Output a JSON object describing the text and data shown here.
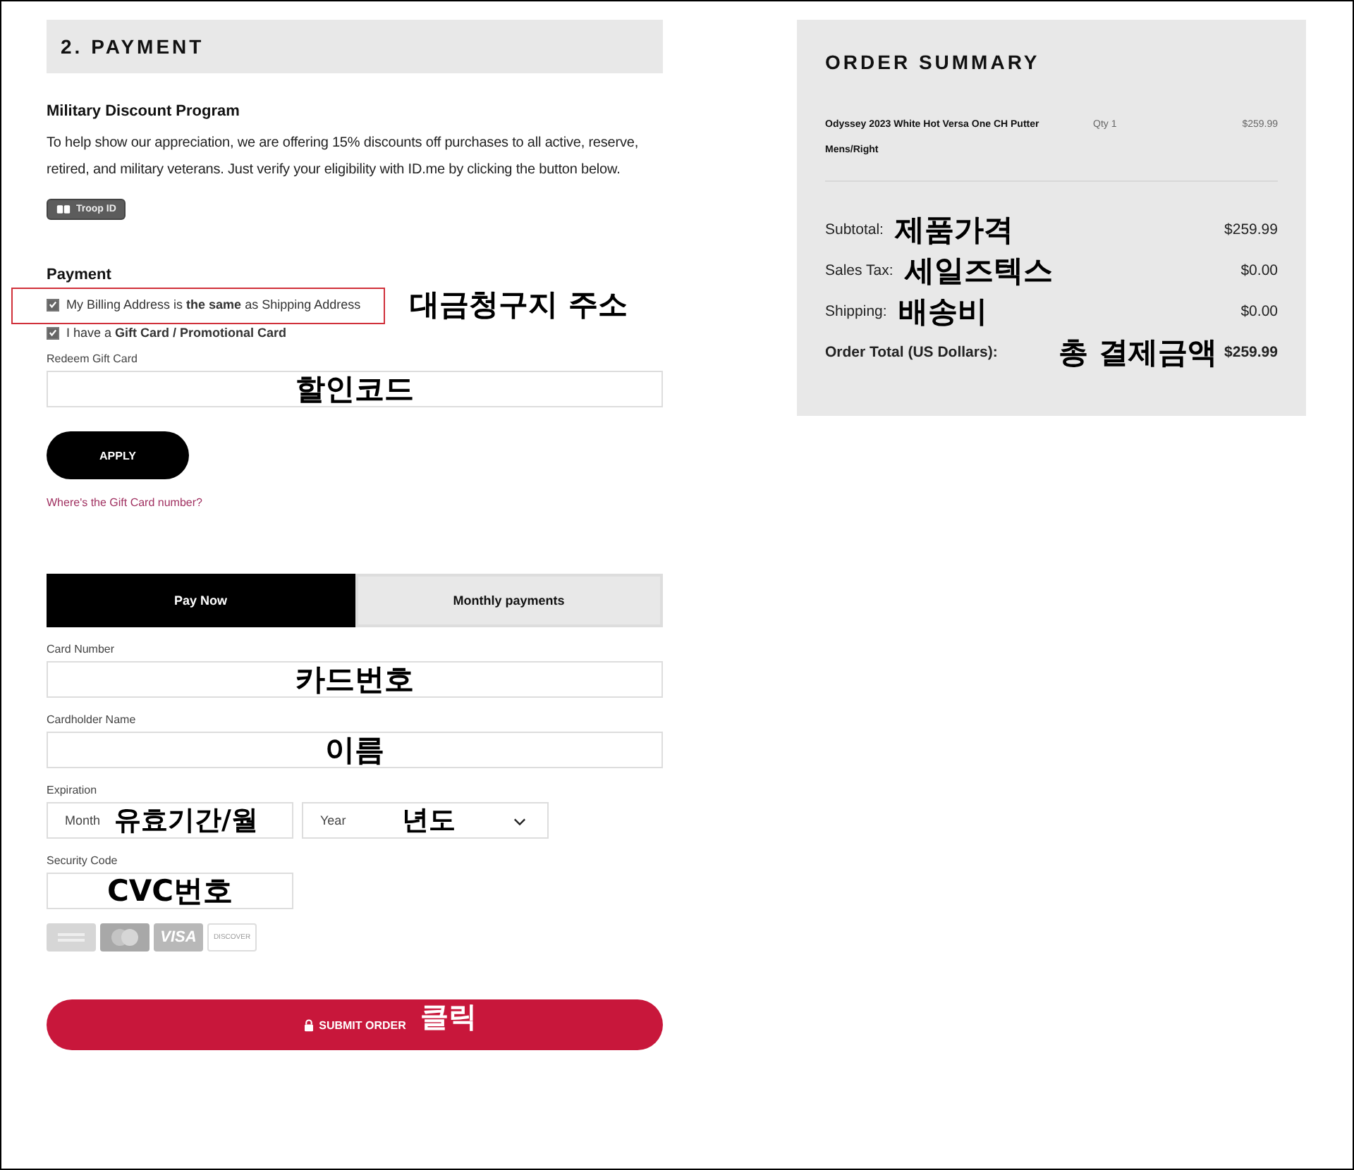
{
  "section": {
    "title": "2. PAYMENT"
  },
  "military": {
    "title": "Military Discount Program",
    "text": "To help show our appreciation, we are offering 15% discounts off purchases to all active, reserve, retired, and military veterans. Just verify your eligibility with ID.me by clicking the button below.",
    "button": "Troop ID"
  },
  "payment": {
    "title": "Payment",
    "options": [
      {
        "label": "My Billing Address is **the same** as Shipping Address",
        "checked": true,
        "highlighted": true,
        "annotation": "대금청구지 주소"
      },
      {
        "label": "I have a **Gift Card / Promotional Card**",
        "checked": true,
        "highlighted": false
      }
    ]
  },
  "gift_card": {
    "label": "Redeem Gift Card",
    "annotation": "할인코드",
    "button": "APPLY",
    "link": "Where's the Gift Card number?"
  },
  "tabs": [
    {
      "label": "Pay Now",
      "selected": true
    },
    {
      "label": "Monthly payments",
      "selected": false
    }
  ],
  "card_fields": [
    {
      "kind": "text",
      "label": "Card Number",
      "annotation": "카드번호"
    },
    {
      "kind": "text",
      "label": "Cardholder Name",
      "annotation": "이름"
    },
    {
      "kind": "expiration",
      "label": "Expiration",
      "month_placeholder": "Month",
      "month_annotation": "유효기간/월",
      "year_placeholder": "Year",
      "year_annotation": "년도"
    },
    {
      "kind": "short",
      "label": "Security Code",
      "annotation": "CVC번호"
    }
  ],
  "card_brands": [
    {
      "kind": "amex"
    },
    {
      "kind": "mastercard"
    },
    {
      "kind": "visa",
      "label": "VISA"
    },
    {
      "kind": "discover",
      "label": "DISCOVER"
    }
  ],
  "submit": {
    "label": "SUBMIT ORDER",
    "annotation": "클릭"
  },
  "summary": {
    "title": "ORDER SUMMARY",
    "item": {
      "name": "Odyssey 2023 White Hot Versa One CH Putter",
      "variant": "Mens/Right",
      "qty": "Qty 1",
      "price": "$259.99"
    },
    "lines": [
      {
        "kind": "normal",
        "label": "Subtotal:",
        "annotation": "제품가격",
        "value": "$259.99"
      },
      {
        "kind": "normal",
        "label": "Sales Tax:",
        "annotation": "세일즈텍스",
        "value": "$0.00"
      },
      {
        "kind": "normal",
        "label": "Shipping:",
        "annotation": "배송비",
        "value": "$0.00"
      },
      {
        "kind": "total",
        "label": "Order Total (US Dollars):",
        "annotation": "총 결제금액",
        "value": "$259.99"
      }
    ]
  }
}
